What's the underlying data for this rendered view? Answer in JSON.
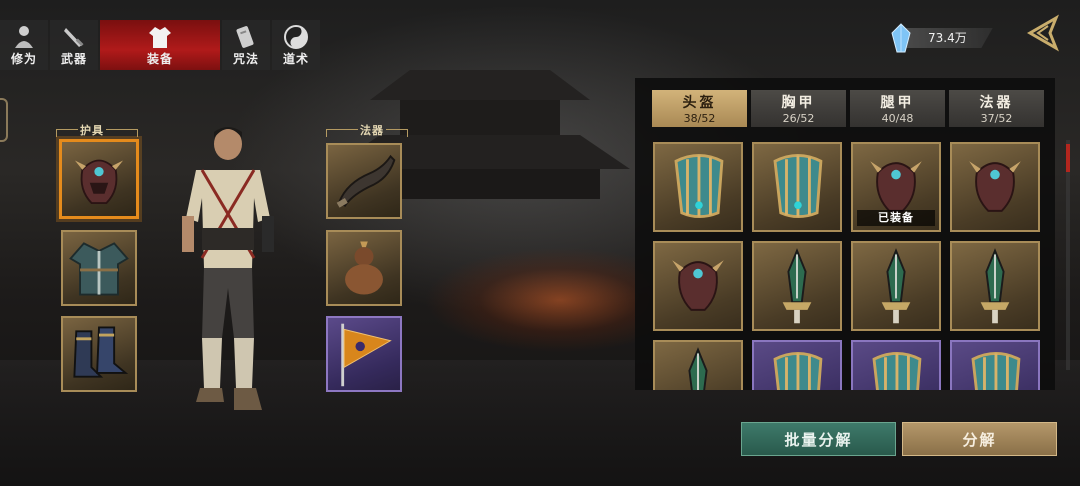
{
  "top_tabs": [
    {
      "label": "修为",
      "icon": "meditating-figure-icon",
      "active": false
    },
    {
      "label": "武器",
      "icon": "sword-icon",
      "active": false
    },
    {
      "label": "装备",
      "icon": "robe-icon",
      "active": true
    },
    {
      "label": "咒法",
      "icon": "talisman-scroll-icon",
      "active": false
    },
    {
      "label": "道术",
      "icon": "yin-yang-icon",
      "active": false
    }
  ],
  "currency": {
    "icon": "blue-crystal-icon",
    "amount": "73.4万"
  },
  "equipment": {
    "armor_label": "护具",
    "artifact_label": "法器",
    "armor_slots": [
      {
        "item": "demon-mask-helmet",
        "selected": true
      },
      {
        "item": "chest-robe",
        "selected": false
      },
      {
        "item": "leg-boots",
        "selected": false
      }
    ],
    "artifact_slots": [
      {
        "item": "horn-artifact",
        "rarity": "gold"
      },
      {
        "item": "gourd-artifact",
        "rarity": "gold"
      },
      {
        "item": "banner-artifact",
        "rarity": "purple"
      }
    ]
  },
  "inventory": {
    "categories": [
      {
        "name": "头盔",
        "count": "38/52",
        "active": true
      },
      {
        "name": "胸甲",
        "count": "26/52",
        "active": false
      },
      {
        "name": "腿甲",
        "count": "40/48",
        "active": false
      },
      {
        "name": "法器",
        "count": "37/52",
        "active": false
      }
    ],
    "items": [
      {
        "item": "bracer",
        "rarity": "gold"
      },
      {
        "item": "bracer",
        "rarity": "gold"
      },
      {
        "item": "demon-mask",
        "rarity": "gold",
        "tag": "已装备"
      },
      {
        "item": "demon-mask",
        "rarity": "gold"
      },
      {
        "item": "demon-mask",
        "rarity": "gold"
      },
      {
        "item": "dagger",
        "rarity": "gold"
      },
      {
        "item": "dagger",
        "rarity": "gold"
      },
      {
        "item": "dagger",
        "rarity": "gold"
      },
      {
        "item": "dagger",
        "rarity": "gold"
      },
      {
        "item": "bracer",
        "rarity": "purple"
      },
      {
        "item": "bracer",
        "rarity": "purple"
      },
      {
        "item": "bracer",
        "rarity": "purple"
      }
    ]
  },
  "buttons": {
    "batch_decompose": "批量分解",
    "decompose": "分解"
  },
  "colors": {
    "active_tab": "#b01a1a",
    "selected_slot": "#e58b1c",
    "gold_slot": "#a88c58",
    "purple_slot": "#8d77c2",
    "batch_button": "#3e7a6a"
  }
}
